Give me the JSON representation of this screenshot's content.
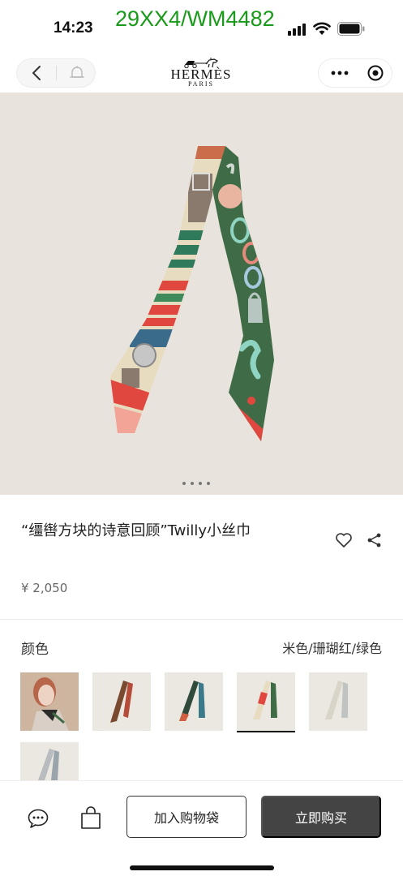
{
  "status_bar": {
    "time": "14:23",
    "watermark": "29XX4/WM4482"
  },
  "nav": {
    "brand_name": "HERMÈS",
    "brand_city": "PARIS",
    "icons": [
      "back-icon",
      "bell-icon",
      "more-icon",
      "target-icon"
    ]
  },
  "product": {
    "title": "“缰辔方块的诗意回顾”Twilly小丝巾",
    "price": "¥ 2,050",
    "carousel_pages": 4,
    "carousel_active": 1
  },
  "color": {
    "label": "颜色",
    "selected_value": "米色/珊瑚红/绿色",
    "swatch_count": 6,
    "selected_index": 3
  },
  "actions": {
    "add_to_cart": "加入购物袋",
    "buy_now": "立即购买"
  },
  "colors": {
    "scarf_green": "#3f6b46",
    "scarf_coral": "#e0473f",
    "scarf_beige": "#e7dcc0",
    "background": "#e8e4dd",
    "buy_button": "#444444"
  }
}
